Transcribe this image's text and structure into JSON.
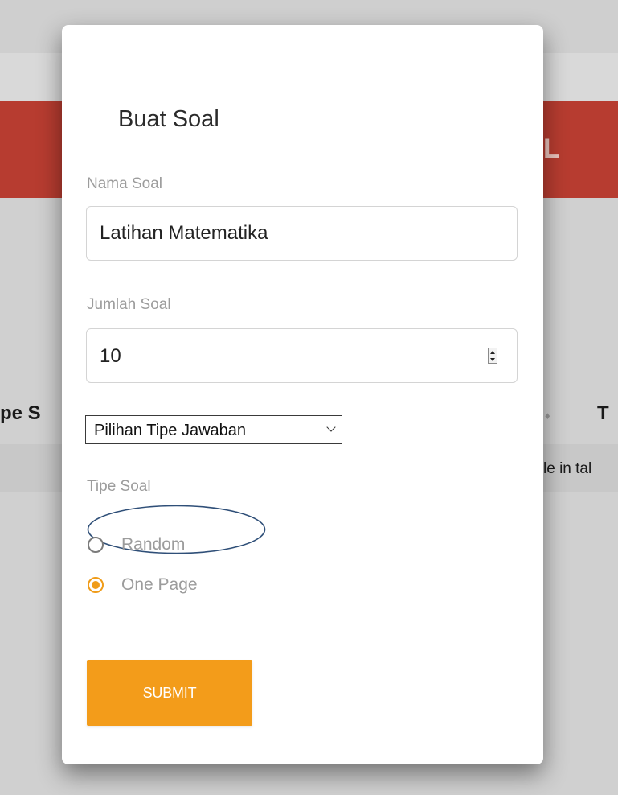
{
  "background": {
    "hero_text": "L",
    "table": {
      "left_header_fragment": "pe S",
      "sort_icon": "sort-icon",
      "right_header_fragment": "T",
      "row_text_fragment": "le in tal"
    }
  },
  "modal": {
    "title": "Buat Soal",
    "nama_soal": {
      "label": "Nama Soal",
      "value": "Latihan Matematika"
    },
    "jumlah_soal": {
      "label": "Jumlah Soal",
      "value": "10"
    },
    "tipe_jawaban": {
      "selected": "Pilihan Tipe Jawaban"
    },
    "tipe_soal": {
      "label": "Tipe Soal",
      "options": [
        {
          "label": "Random",
          "checked": false
        },
        {
          "label": "One Page",
          "checked": true
        }
      ]
    },
    "submit_label": "SUBMIT"
  },
  "colors": {
    "accent": "#f39c1a",
    "hero_red": "#b73c30",
    "highlight_ellipse": "#2f4f78"
  }
}
